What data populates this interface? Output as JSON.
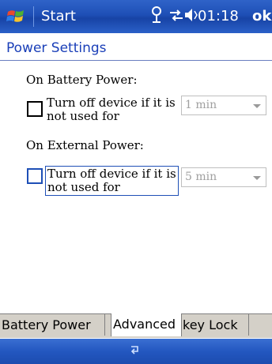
{
  "titlebar": {
    "start_label": "Start",
    "time": "01:18",
    "ok_label": "ok",
    "icons": [
      "windows-logo-icon",
      "antenna-icon",
      "connectivity-icon",
      "volume-icon"
    ]
  },
  "page": {
    "title": "Power Settings"
  },
  "battery": {
    "section": "On Battery Power:",
    "checkbox_label_line1": "Turn off device if it is",
    "checkbox_label_line2": "not used for",
    "checked": false,
    "select_value": "1 min"
  },
  "external": {
    "section": "On External Power:",
    "checkbox_label_line1": "Turn off device if it is",
    "checkbox_label_line2": "not used for",
    "checked": false,
    "select_value": "5 min"
  },
  "tabs": [
    {
      "label": "Battery Power",
      "active": false
    },
    {
      "label": "Advanced",
      "active": true
    },
    {
      "label": "key Lock",
      "active": false
    }
  ],
  "softbar": {
    "icon": "sip-keyboard-icon"
  }
}
